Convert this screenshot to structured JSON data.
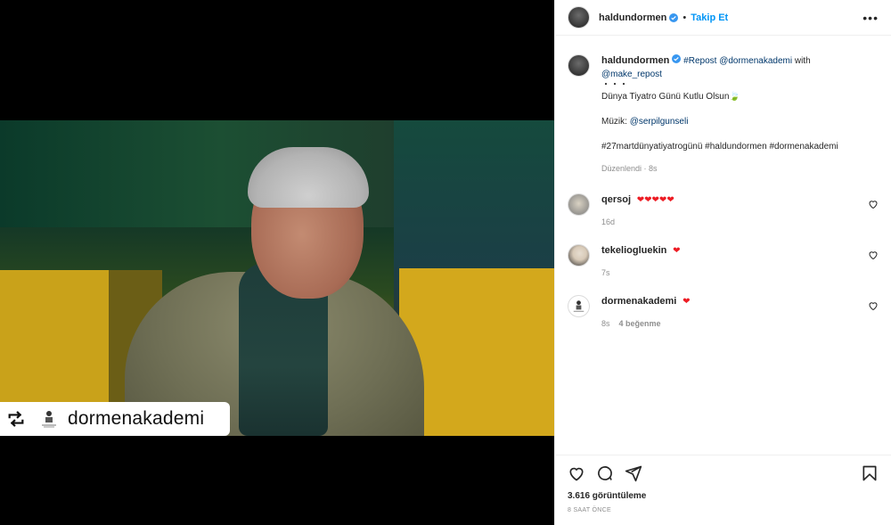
{
  "post": {
    "author": "haldundormen",
    "follow_label": "Takip Et",
    "more_label": "•••",
    "caption": {
      "line1_hash": "#Repost",
      "line1_mention": "@dormenakademi",
      "line1_with": "with",
      "line1_mention2": "@make_repost",
      "line2": "・・・",
      "line3": "Dünya Tiyatro Günü Kutlu Olsun🍃",
      "line4_prefix": "Müzik:",
      "line4_mention": "@serpilgunseli",
      "tags": "#27martdünyatiyatrogünü #haldundormen #dormenakademi",
      "edited": "Düzenlendi",
      "edited_time": "8s"
    },
    "repost_overlay": {
      "name": "dormenakademi"
    }
  },
  "comments": [
    {
      "user": "qersoj",
      "text": "❤❤❤❤❤",
      "time": "16d",
      "likes": ""
    },
    {
      "user": "tekeliogluekin",
      "text": "❤",
      "time": "7s",
      "likes": ""
    },
    {
      "user": "dormenakademi",
      "text": "❤",
      "time": "8s",
      "likes": "4 beğenme"
    }
  ],
  "stats": {
    "views": "3.616 görüntüleme",
    "time_ago": "8 SAAT ÖNCE"
  },
  "colors": {
    "link": "#00376b",
    "follow": "#0095f6",
    "heart": "#ed1c24",
    "verified": "#3897f0"
  },
  "icons": [
    "verified-icon",
    "heart-icon",
    "comment-icon",
    "share-icon",
    "bookmark-icon",
    "repost-icon"
  ]
}
